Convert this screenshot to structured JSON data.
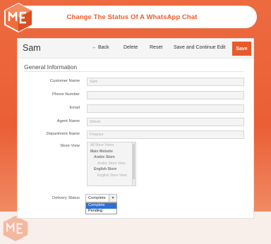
{
  "banner": {
    "title": "Change The Status Of A WhatsApp Chat"
  },
  "colors": {
    "brand_orange": "#ed5b2c",
    "save_button": "#e85a2a",
    "selected_option": "#2f6fd6"
  },
  "header": {
    "record_title": "Sam",
    "back_icon": "arrow-left-icon",
    "back_label": "Back",
    "delete_label": "Delete",
    "reset_label": "Reset",
    "save_continue_label": "Save and Continue Edit",
    "save_label": "Save"
  },
  "form": {
    "section_title": "General Information",
    "fields": {
      "customer_name": {
        "label": "Customer Name",
        "value": "Sam"
      },
      "phone_number": {
        "label": "Phone Number",
        "value": ""
      },
      "email": {
        "label": "Email",
        "value": ""
      },
      "agent_name": {
        "label": "Agent Name",
        "value": "Simon"
      },
      "department_name": {
        "label": "Department Name",
        "value": "Finance"
      }
    },
    "store_view": {
      "label": "Store View",
      "options": [
        {
          "text": "All Store Views",
          "type": "option"
        },
        {
          "text": "Main Website",
          "type": "group"
        },
        {
          "text": "Arabic Store",
          "type": "subgroup"
        },
        {
          "text": "Arabic Store View",
          "type": "option"
        },
        {
          "text": "English Store",
          "type": "subgroup"
        },
        {
          "text": "English Store View",
          "type": "option"
        }
      ]
    },
    "delivery_status": {
      "label": "Delivery Status",
      "selected": "Complete",
      "options": [
        "Complete",
        "Pending"
      ]
    }
  }
}
